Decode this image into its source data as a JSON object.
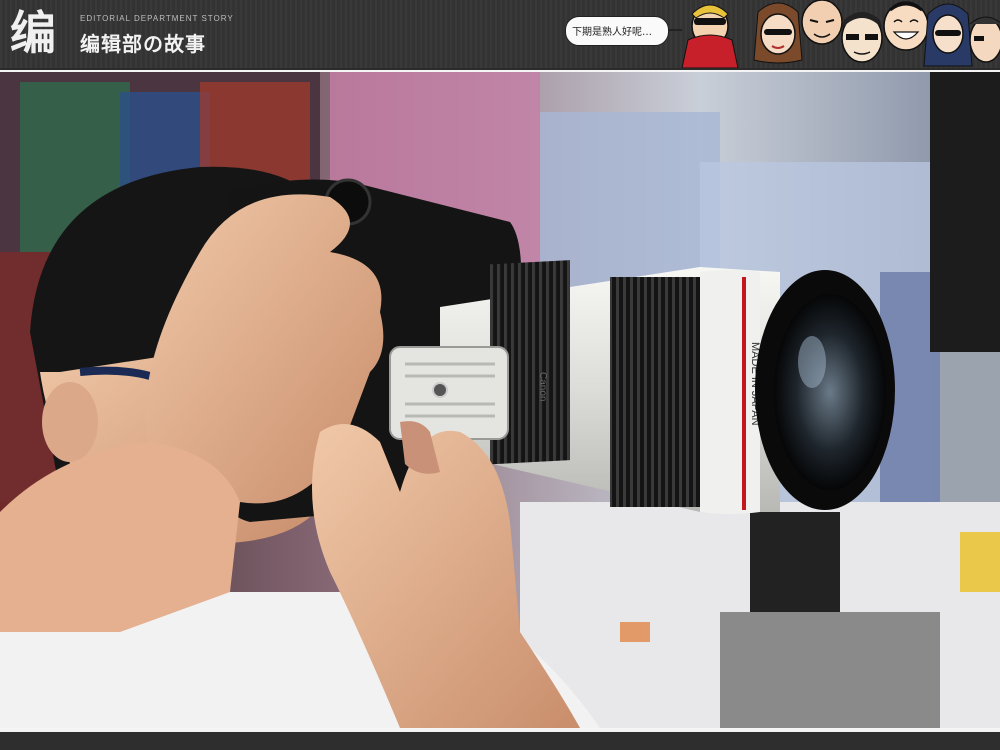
{
  "header": {
    "logo_glyph": "编",
    "brand_en": "EDITORIAL DEPARTMENT STORY",
    "brand_cn": "编辑部の故事",
    "bubble_text": "下期是熟人好呢…"
  },
  "colors": {
    "header_bg": "#333333",
    "frame": "#f5f5f5",
    "lens_white": "#e9e9e6",
    "lens_red_ring": "#c4161c",
    "camera_black": "#151515"
  },
  "photo": {
    "lens_text": "MADE IN JAPAN",
    "lens_brand": "Canon"
  }
}
